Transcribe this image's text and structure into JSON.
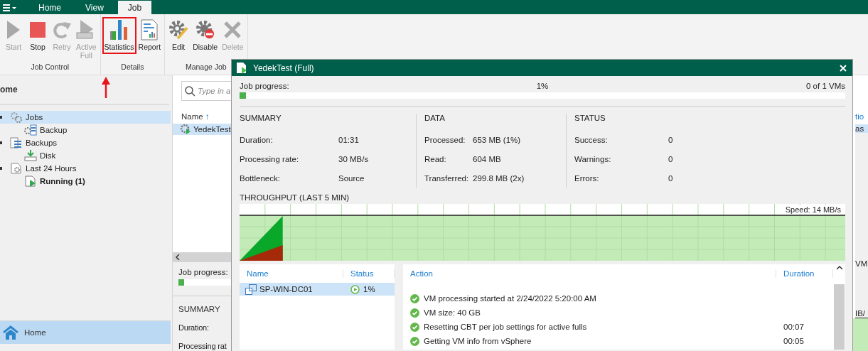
{
  "menu_tabs": [
    {
      "label": "Home",
      "selected": false
    },
    {
      "label": "View",
      "selected": false
    },
    {
      "label": "Job",
      "selected": true
    }
  ],
  "ribbon": {
    "groups": [
      {
        "label": "Job Control",
        "buttons": [
          {
            "label": "Start",
            "kind": "start",
            "disabled": true,
            "highlighted": false
          },
          {
            "label": "Stop",
            "kind": "stop",
            "disabled": false,
            "highlighted": false
          },
          {
            "label": "Retry",
            "kind": "retry",
            "disabled": true,
            "highlighted": false
          },
          {
            "label": "Active Full",
            "kind": "activefull",
            "disabled": true,
            "highlighted": false
          }
        ]
      },
      {
        "label": "Details",
        "buttons": [
          {
            "label": "Statistics",
            "kind": "statistics",
            "disabled": false,
            "highlighted": true
          },
          {
            "label": "Report",
            "kind": "report",
            "disabled": false,
            "highlighted": false
          }
        ]
      },
      {
        "label": "Manage Job",
        "buttons": [
          {
            "label": "Edit",
            "kind": "edit",
            "disabled": false,
            "highlighted": false
          },
          {
            "label": "Disable",
            "kind": "disable",
            "disabled": false,
            "highlighted": false
          },
          {
            "label": "Delete",
            "kind": "delete",
            "disabled": true,
            "highlighted": false
          }
        ]
      }
    ]
  },
  "sidebar": {
    "title": "ome",
    "tree": [
      {
        "label": "Jobs",
        "kind": "jobs",
        "selected": true,
        "bold": false,
        "children": [
          {
            "label": "Backup",
            "kind": "backupjob",
            "selected": false,
            "bold": false
          }
        ]
      },
      {
        "label": "Backups",
        "kind": "backups",
        "selected": false,
        "bold": false,
        "children": [
          {
            "label": "Disk",
            "kind": "disk",
            "selected": false,
            "bold": false
          }
        ]
      },
      {
        "label": "Last 24 Hours",
        "kind": "last24",
        "selected": false,
        "bold": false,
        "children": [
          {
            "label": "Running (1)",
            "kind": "running",
            "selected": false,
            "bold": true
          }
        ]
      }
    ],
    "nav": [
      {
        "label": "Home",
        "selected": true
      }
    ]
  },
  "jobs_panel": {
    "search_placeholder": "Type in a",
    "column": "Name",
    "sort_arrow": "↑",
    "rows": [
      {
        "name": "YedekTest",
        "selected": true
      }
    ],
    "progress_label": "Job progress:",
    "progress": {
      "level": 0.01
    },
    "summary_title": "SUMMARY",
    "fields": [
      "Duration:",
      "Processing rat"
    ]
  },
  "right_edge": {
    "column_header": "tio",
    "cell": "as",
    "progress_fragment": "VM",
    "speed_fragment": "IB/"
  },
  "dialog": {
    "title": "YedekTest (Full)",
    "progress": {
      "label": "Job progress:",
      "percent": "1%",
      "count": "0 of 1 VMs",
      "level": 0.01
    },
    "sections": [
      {
        "title": "SUMMARY",
        "rows": [
          {
            "label": "Duration:",
            "value": "01:31"
          },
          {
            "label": "Processing rate:",
            "value": "30 MB/s"
          },
          {
            "label": "Bottleneck:",
            "value": "Source"
          }
        ]
      },
      {
        "title": "DATA",
        "rows": [
          {
            "label": "Processed:",
            "value": "653 MB (1%)"
          },
          {
            "label": "Read:",
            "value": "604 MB"
          },
          {
            "label": "Transferred:",
            "value": "299.8 MB (2x)"
          }
        ]
      },
      {
        "title": "STATUS",
        "rows": [
          {
            "label": "Success:",
            "value": "0"
          },
          {
            "label": "Warnings:",
            "value": "0"
          },
          {
            "label": "Errors:",
            "value": "0"
          }
        ]
      }
    ],
    "throughput": {
      "title": "THROUGHPUT (LAST 5 MIN)",
      "speed": "Speed: 14 MB/s"
    },
    "vms": {
      "columns": [
        "Name",
        "Status"
      ],
      "rows": [
        {
          "name": "SP-WIN-DC01",
          "status": "1%",
          "selected": true
        }
      ]
    },
    "log": {
      "columns": [
        "Action",
        "Duration"
      ],
      "rows": [
        {
          "action": "VM processing started at 2/24/2022 5:20:00 AM"
        },
        {
          "action": "VM size: 40 GB"
        },
        {
          "action": "Resetting CBT per job settings for active fulls",
          "duration": "00:07"
        },
        {
          "action": "Getting VM info from vSphere",
          "duration": "00:05"
        }
      ]
    }
  }
}
